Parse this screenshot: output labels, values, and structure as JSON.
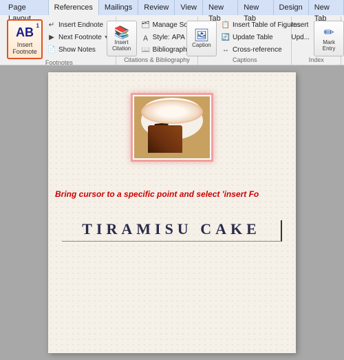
{
  "ribbon": {
    "tabs": [
      {
        "label": "Page Layout",
        "active": false
      },
      {
        "label": "References",
        "active": true
      },
      {
        "label": "Mailings",
        "active": false
      },
      {
        "label": "Review",
        "active": false
      },
      {
        "label": "View",
        "active": false
      },
      {
        "label": "New Tab",
        "active": false
      },
      {
        "label": "New Tab",
        "active": false
      },
      {
        "label": "Design",
        "active": false
      },
      {
        "label": "New Tab",
        "active": false
      }
    ],
    "groups": {
      "footnotes": {
        "label": "Footnotes",
        "insert_footnote": "Insert\nFootnote",
        "insert_endnote": "Insert Endnote",
        "next_footnote": "Next Footnote",
        "show_notes": "Show Notes"
      },
      "citations": {
        "label": "Citations & Bibliography",
        "manage_sources": "Manage Sources",
        "style": "Style:",
        "style_value": "APA Fift",
        "insert_citation": "Insert\nCitation",
        "bibliography": "Bibliography"
      },
      "captions": {
        "label": "Captions",
        "insert_caption": "Insert Caption",
        "insert_table_of_figures": "Insert Table of Figures",
        "update_table": "Update Table",
        "cross_reference": "Cross-reference"
      },
      "index": {
        "label": "Index",
        "mark_entry": "Mark\nEntry",
        "insert_index": "Insert",
        "update_index": "Upd..."
      }
    }
  },
  "document": {
    "instruction": "Bring cursor to a specific point and select 'insert Fo",
    "title": "TIRAMISU CAKE"
  },
  "caption_label": "Caption"
}
